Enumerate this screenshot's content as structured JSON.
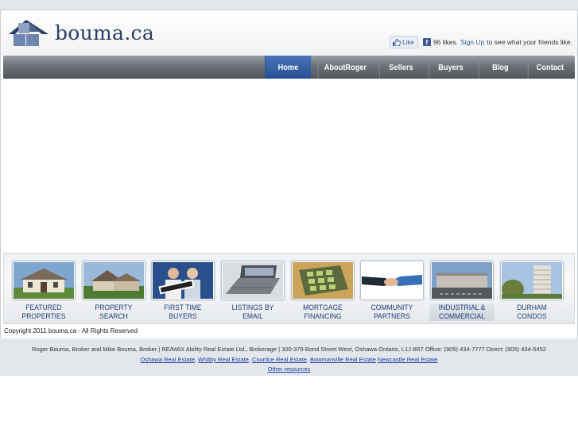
{
  "brand": {
    "name": "bouma.ca",
    "color": "#2d3f63"
  },
  "facebook": {
    "like_label": "Like",
    "likes_text": "96 likes.",
    "signup_label": "Sign Up",
    "signup_suffix": "to see what your friends like."
  },
  "nav": {
    "items": [
      {
        "label": "Home",
        "active": true
      },
      {
        "label": "AboutRoger",
        "active": false
      },
      {
        "label": "Sellers",
        "active": false
      },
      {
        "label": "Buyers",
        "active": false
      },
      {
        "label": "Blog",
        "active": false
      },
      {
        "label": "Contact",
        "active": false
      }
    ],
    "active_color": "#2c5aa0"
  },
  "features": [
    {
      "line1": "FEATURED",
      "line2": "PROPERTIES"
    },
    {
      "line1": "PROPERTY",
      "line2": "SEARCH"
    },
    {
      "line1": "FIRST TIME",
      "line2": "BUYERS"
    },
    {
      "line1": "LISTINGS BY",
      "line2": "EMAIL"
    },
    {
      "line1": "MORTGAGE",
      "line2": "FINANCING"
    },
    {
      "line1": "COMMUNITY",
      "line2": "PARTNERS"
    },
    {
      "line1": "INDUSTRIAL &",
      "line2": "COMMERCIAL"
    },
    {
      "line1": "DURHAM",
      "line2": "CONDOS"
    }
  ],
  "copyright": "Copyright 2011 bouma.ca - All Rights Reserved",
  "footer": {
    "address": "Roger Bouma, Broker and Mike Bouma, Broker | RE/MAX Ability Real Estate Ltd., Brokerage | 300-379 Bond Street West, Oshawa Ontario, L1J 8R7 Office: (905) 434-7777 Direct: (905) 434-5452",
    "links": [
      "Oshawa Real Estate",
      "Whitby Real Estate",
      "Courtice Real Estate",
      "Bowmanville Real Estate",
      "Newcastle Real Estate"
    ],
    "other": "Other resources"
  }
}
